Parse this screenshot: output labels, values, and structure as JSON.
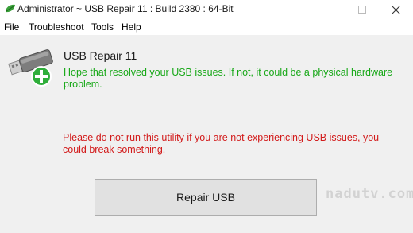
{
  "window": {
    "title": "Administrator ~ USB Repair 11 : Build 2380 : 64-Bit",
    "icon": "green-leaf-icon",
    "controls": [
      "minimize",
      "maximize",
      "close"
    ]
  },
  "menu": {
    "file": "File",
    "troubleshoot": "Troubleshoot",
    "tools": "Tools",
    "help": "Help"
  },
  "content": {
    "icon": "usb-drive-add-icon",
    "heading": "USB Repair 11",
    "success_message": "Hope that resolved your USB issues. If not, it could be a physical hardware problem.",
    "warning_message": "Please do not run this utility if you are not experiencing USB issues, you could break something.",
    "repair_button": "Repair USB",
    "watermark": "nadutv.com"
  },
  "colors": {
    "success_text": "#18a818",
    "warning_text": "#d21a1a",
    "client_background": "#f0f0f0"
  }
}
